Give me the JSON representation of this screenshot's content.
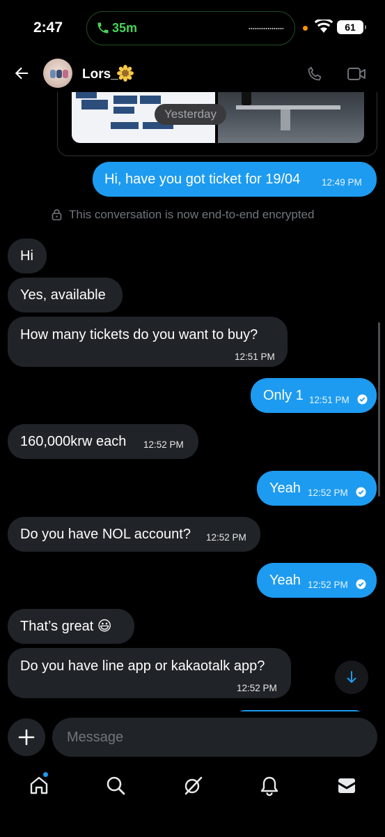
{
  "status_bar": {
    "time": "2:47",
    "call_duration": "35m",
    "battery": "61"
  },
  "header": {
    "contact_name": "Lors_"
  },
  "media": {
    "date_chip": "Yesterday"
  },
  "encryption_note": "This conversation is now end-to-end encrypted",
  "messages": [
    {
      "direction": "out",
      "text": "Hi, have you got ticket for 19/04",
      "time": "12:49 PM"
    },
    {
      "direction": "in",
      "text": "Hi",
      "time": ""
    },
    {
      "direction": "in",
      "text": "Yes, available",
      "time": ""
    },
    {
      "direction": "in",
      "text": "How many tickets do you want to buy?",
      "time": "12:51 PM"
    },
    {
      "direction": "out",
      "text": "Only 1",
      "time": "12:51 PM",
      "read": true
    },
    {
      "direction": "in",
      "text": "160,000krw each",
      "time": "12:52 PM"
    },
    {
      "direction": "out",
      "text": "Yeah",
      "time": "12:52 PM",
      "read": true
    },
    {
      "direction": "in",
      "text": "Do you have NOL account?",
      "time": "12:52 PM"
    },
    {
      "direction": "out",
      "text": "Yeah",
      "time": "12:52 PM",
      "read": true
    },
    {
      "direction": "in",
      "text": "That’s great 😃",
      "time": ""
    },
    {
      "direction": "in",
      "text": "Do you have line app or kakaotalk app?",
      "time": "12:52 PM"
    }
  ],
  "composer": {
    "placeholder": "Message"
  },
  "nav": {
    "items": [
      "home-icon",
      "search-icon",
      "grok-icon",
      "notifications-icon",
      "messages-icon"
    ],
    "home_has_badge": true
  },
  "colors": {
    "accent": "#1d9bf0",
    "incoming_bubble": "#202327",
    "background": "#000000",
    "call_green": "#4ad15b"
  }
}
